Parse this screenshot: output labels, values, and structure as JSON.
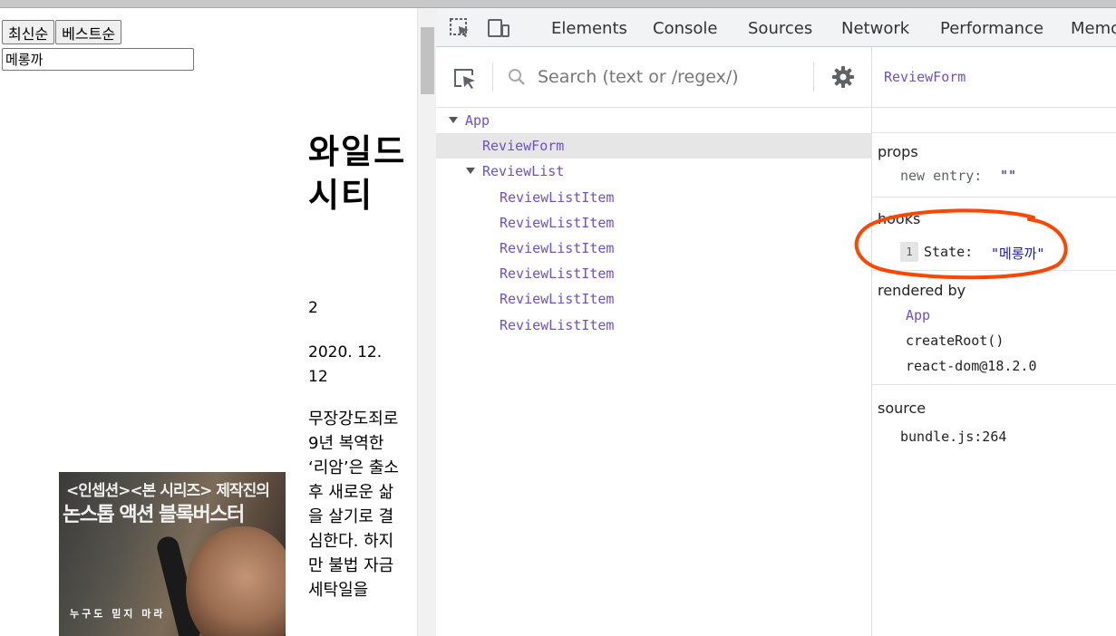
{
  "page": {
    "sort_buttons": [
      "최신순",
      "베스트순"
    ],
    "input_value": "메롱까",
    "movie": {
      "title": "와일드 시티",
      "rating": "2",
      "date": "2020. 12. 12",
      "description": "무장강도죄로 9년 복역한 ‘리암’은 출소 후 새로운 삶을 살기로 결심한다. 하지만 불법 자금 세탁일을"
    },
    "poster": {
      "line1": "<인셉션><본 시리즈> 제작진의",
      "line2": "논스톱 액션 블록버스터",
      "tagline": "누구도 믿지 마라"
    }
  },
  "devtools": {
    "tabs": [
      "Elements",
      "Console",
      "Sources",
      "Network",
      "Performance",
      "Memo"
    ],
    "search_placeholder": "Search (text or /regex/)",
    "tree": [
      {
        "name": "App",
        "depth": 0,
        "expanded": true,
        "selected": false
      },
      {
        "name": "ReviewForm",
        "depth": 1,
        "expanded": false,
        "selected": true
      },
      {
        "name": "ReviewList",
        "depth": 1,
        "expanded": true,
        "selected": false
      },
      {
        "name": "ReviewListItem",
        "depth": 2,
        "expanded": false,
        "selected": false
      },
      {
        "name": "ReviewListItem",
        "depth": 2,
        "expanded": false,
        "selected": false
      },
      {
        "name": "ReviewListItem",
        "depth": 2,
        "expanded": false,
        "selected": false
      },
      {
        "name": "ReviewListItem",
        "depth": 2,
        "expanded": false,
        "selected": false
      },
      {
        "name": "ReviewListItem",
        "depth": 2,
        "expanded": false,
        "selected": false
      },
      {
        "name": "ReviewListItem",
        "depth": 2,
        "expanded": false,
        "selected": false
      }
    ],
    "selected_component": "ReviewForm",
    "props": {
      "title": "props",
      "key": "new entry:",
      "value": "\"\""
    },
    "hooks": {
      "title": "hooks",
      "index": "1",
      "key": "State:",
      "value": "\"메롱까\""
    },
    "rendered_by": {
      "title": "rendered by",
      "items": [
        "App",
        "createRoot()",
        "react-dom@18.2.0"
      ]
    },
    "source": {
      "title": "source",
      "value": "bundle.js:264"
    }
  },
  "colors": {
    "component": "#6f4fc7",
    "string_value": "#1a1aa6",
    "annotation": "#ff4500"
  }
}
